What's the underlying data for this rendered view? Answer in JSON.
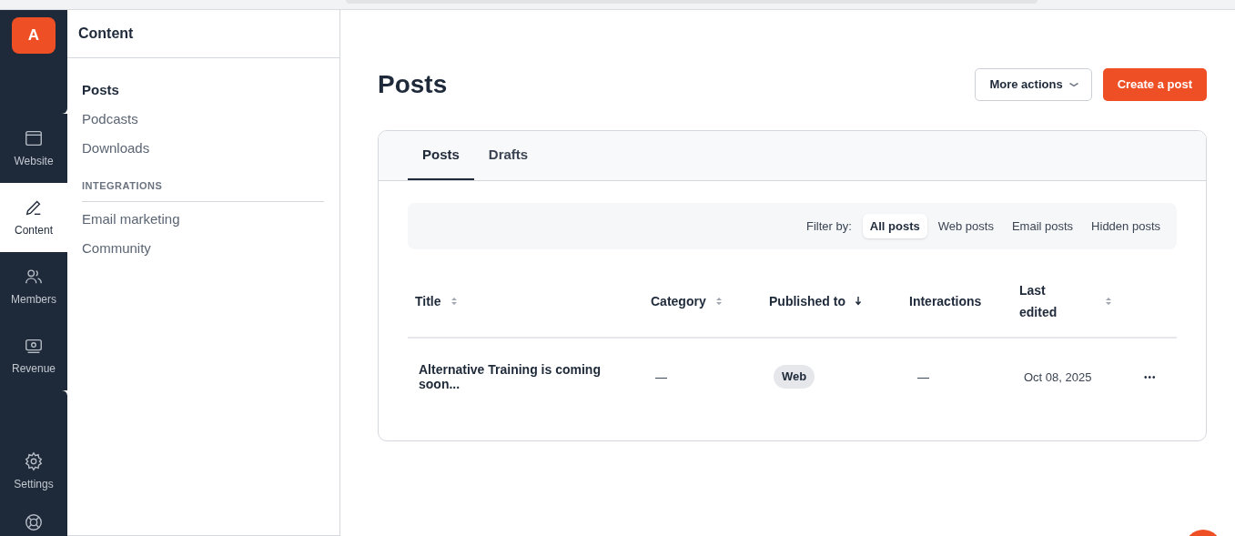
{
  "rail": {
    "logo": "A",
    "items": [
      {
        "label": "Website",
        "selected": false
      },
      {
        "label": "Content",
        "selected": true
      },
      {
        "label": "Members",
        "selected": false
      },
      {
        "label": "Revenue",
        "selected": false
      }
    ],
    "bottom_items": [
      {
        "label": "Settings"
      }
    ]
  },
  "sidebar": {
    "title": "Content",
    "items": [
      {
        "label": "Posts",
        "selected": true
      },
      {
        "label": "Podcasts",
        "selected": false
      },
      {
        "label": "Downloads",
        "selected": false
      }
    ],
    "section": "INTEGRATIONS",
    "section_items": [
      {
        "label": "Email marketing",
        "selected": false
      },
      {
        "label": "Community",
        "selected": false
      }
    ]
  },
  "page": {
    "title": "Posts",
    "more_actions": "More actions",
    "create": "Create a post"
  },
  "tabs": [
    {
      "label": "Posts",
      "selected": true
    },
    {
      "label": "Drafts",
      "selected": false
    }
  ],
  "filter": {
    "label": "Filter by:",
    "options": [
      {
        "label": "All posts",
        "selected": true
      },
      {
        "label": "Web posts",
        "selected": false
      },
      {
        "label": "Email posts",
        "selected": false
      },
      {
        "label": "Hidden posts",
        "selected": false
      }
    ]
  },
  "table": {
    "columns": [
      {
        "label": "Title",
        "kind": "sortable"
      },
      {
        "label": "Category",
        "kind": "sortable"
      },
      {
        "label": "Published to",
        "kind": "sorted"
      },
      {
        "label": "Interactions",
        "kind": "plain"
      },
      {
        "label": "Last edited",
        "kind": "sortable"
      }
    ],
    "rows": [
      {
        "title": "Alternative Training is coming soon...",
        "category": "—",
        "published_to": "Web",
        "interactions": "—",
        "last_edited": "Oct 08, 2025",
        "menu": "•••"
      }
    ]
  }
}
